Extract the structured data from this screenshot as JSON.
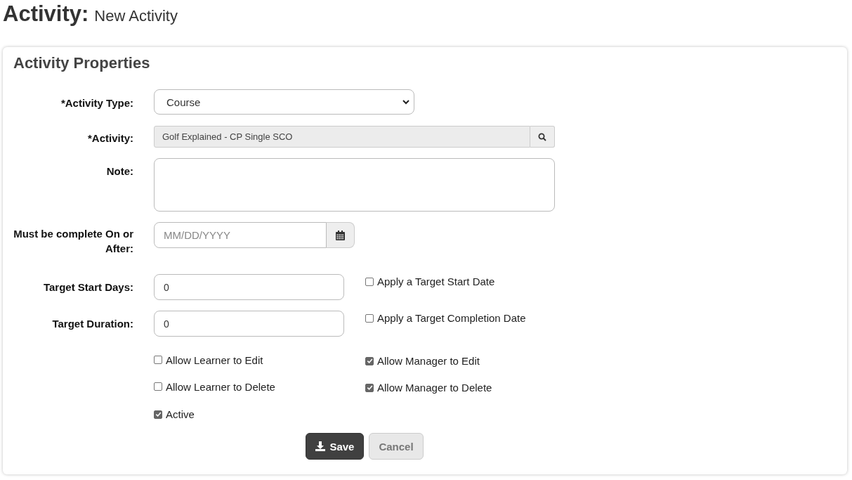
{
  "page_title": {
    "heading": "Activity:",
    "subtitle": "New Activity"
  },
  "panel": {
    "title": "Activity Properties",
    "fields": [
      {
        "kind": "select",
        "label": "*Activity Type:",
        "value": "Course"
      },
      {
        "kind": "lookup",
        "label": "*Activity:",
        "value": "Golf Explained - CP Single SCO"
      },
      {
        "kind": "textarea",
        "label": "Note:"
      },
      {
        "kind": "date",
        "label": "Must be complete On or After:",
        "placeholder": "MM/DD/YYYY"
      },
      {
        "kind": "number",
        "label": "Target Start Days:",
        "value": "0",
        "option": {
          "label": "Apply a Target Start Date",
          "checked": false
        }
      },
      {
        "kind": "number",
        "label": "Target Duration:",
        "value": "0",
        "option": {
          "label": "Apply a Target Completion Date",
          "checked": false
        }
      }
    ],
    "checkbox_rows": [
      [
        {
          "label": "Allow Learner to Edit",
          "checked": false
        },
        {
          "label": "Allow Manager to Edit",
          "checked": true
        }
      ],
      [
        {
          "label": "Allow Learner to Delete",
          "checked": false
        },
        {
          "label": "Allow Manager to Delete",
          "checked": true
        }
      ],
      [
        {
          "label": "Active",
          "checked": true
        }
      ]
    ],
    "buttons": [
      {
        "kind": "primary",
        "label": "Save"
      },
      {
        "kind": "secondary",
        "label": "Cancel"
      }
    ]
  }
}
